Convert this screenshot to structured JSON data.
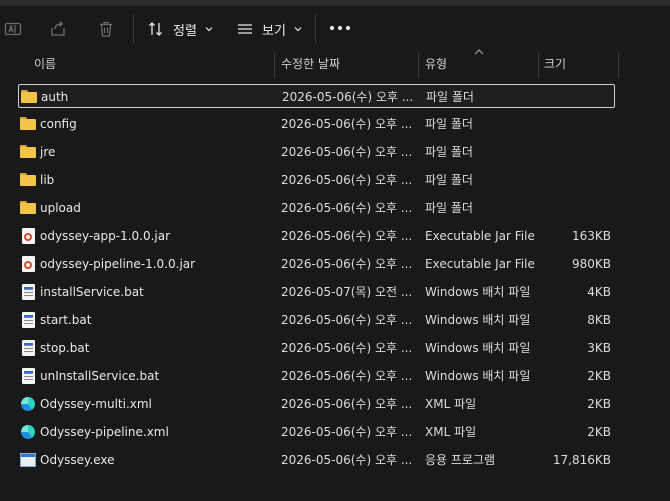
{
  "toolbar": {
    "sort_label": "정렬",
    "view_label": "보기"
  },
  "columns": {
    "name": "이름",
    "date": "수정한 날짜",
    "type": "유형",
    "size": "크기"
  },
  "files": [
    {
      "name": "auth",
      "date": "2026-05-06(수) 오후 ...",
      "type": "파일 폴더",
      "size": "",
      "icon": "folder-icon"
    },
    {
      "name": "config",
      "date": "2026-05-06(수) 오후 ...",
      "type": "파일 폴더",
      "size": "",
      "icon": "folder-icon"
    },
    {
      "name": "jre",
      "date": "2026-05-06(수) 오후 ...",
      "type": "파일 폴더",
      "size": "",
      "icon": "folder-icon"
    },
    {
      "name": "lib",
      "date": "2026-05-06(수) 오후 ...",
      "type": "파일 폴더",
      "size": "",
      "icon": "folder-icon"
    },
    {
      "name": "upload",
      "date": "2026-05-06(수) 오후 ...",
      "type": "파일 폴더",
      "size": "",
      "icon": "folder-icon"
    },
    {
      "name": "odyssey-app-1.0.0.jar",
      "date": "2026-05-06(수) 오후 ...",
      "type": "Executable Jar File",
      "size": "163KB",
      "icon": "jar-file-icon"
    },
    {
      "name": "odyssey-pipeline-1.0.0.jar",
      "date": "2026-05-06(수) 오후 ...",
      "type": "Executable Jar File",
      "size": "980KB",
      "icon": "jar-file-icon"
    },
    {
      "name": "installService.bat",
      "date": "2026-05-07(목) 오전 ...",
      "type": "Windows 배치 파일",
      "size": "4KB",
      "icon": "batch-file-icon"
    },
    {
      "name": "start.bat",
      "date": "2026-05-06(수) 오후 ...",
      "type": "Windows 배치 파일",
      "size": "8KB",
      "icon": "batch-file-icon"
    },
    {
      "name": "stop.bat",
      "date": "2026-05-06(수) 오후 ...",
      "type": "Windows 배치 파일",
      "size": "3KB",
      "icon": "batch-file-icon"
    },
    {
      "name": "unInstallService.bat",
      "date": "2026-05-06(수) 오후 ...",
      "type": "Windows 배치 파일",
      "size": "2KB",
      "icon": "batch-file-icon"
    },
    {
      "name": "Odyssey-multi.xml",
      "date": "2026-05-06(수) 오후 ...",
      "type": "XML 파일",
      "size": "2KB",
      "icon": "xml-file-icon"
    },
    {
      "name": "Odyssey-pipeline.xml",
      "date": "2026-05-06(수) 오후 ...",
      "type": "XML 파일",
      "size": "2KB",
      "icon": "xml-file-icon"
    },
    {
      "name": "Odyssey.exe",
      "date": "2026-05-06(수) 오후 ...",
      "type": "응용 프로그램",
      "size": "17,816KB",
      "icon": "exe-file-icon"
    }
  ]
}
